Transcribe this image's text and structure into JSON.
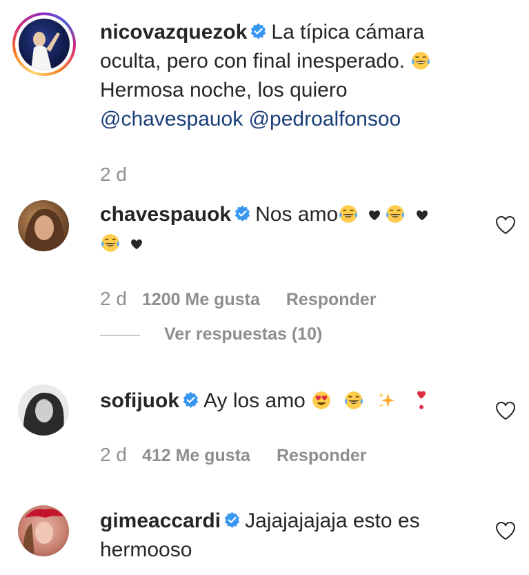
{
  "post": {
    "username": "nicovazquezok",
    "line1": "La típica cámara",
    "line2": "oculta, pero con final inesperado.",
    "line3": "Hermosa noche, los quiero",
    "mention1": "@chavespauok",
    "mention2": "@pedroalfonsoo",
    "time": "2 d"
  },
  "comments": [
    {
      "username": "chavespauok",
      "text": "Nos amo",
      "time": "2 d",
      "likes": "1200 Me gusta",
      "reply": "Responder",
      "view_replies": "Ver respuestas (10)"
    },
    {
      "username": "sofijuok",
      "text": "Ay los amo",
      "time": "2 d",
      "likes": "412 Me gusta",
      "reply": "Responder"
    },
    {
      "username": "gimeaccardi",
      "text_line1": "Jajajajajaja esto es",
      "text_line2": "hermooso"
    }
  ],
  "colors": {
    "verified": "#3897f0",
    "mention": "#1b3f7a",
    "meta": "#8e8e8e"
  },
  "icons": [
    "verified-badge-icon",
    "heart-outline-icon",
    "laughing-emoji-icon",
    "heart-eyes-emoji-icon",
    "sparkles-emoji-icon",
    "red-exclamation-emoji-icon",
    "black-heart-icon"
  ]
}
